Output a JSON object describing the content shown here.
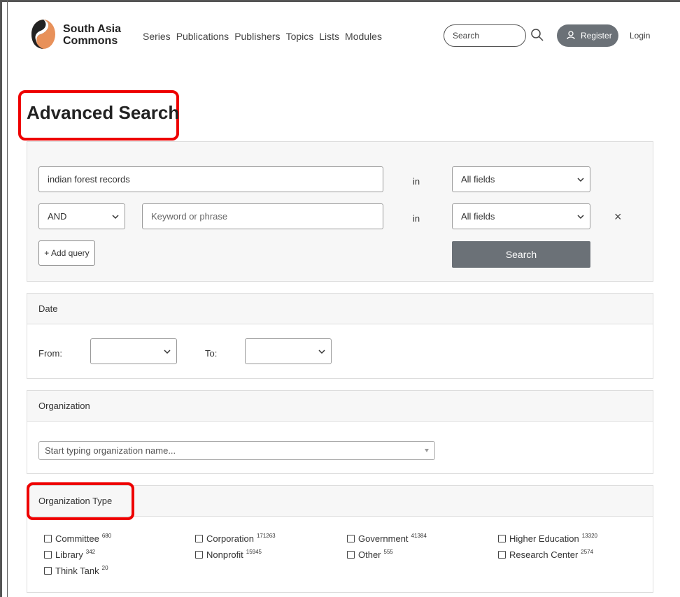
{
  "header": {
    "brand_line1": "South Asia",
    "brand_line2": "Commons",
    "nav": [
      "Series",
      "Publications",
      "Publishers",
      "Topics",
      "Lists",
      "Modules"
    ],
    "search_placeholder": "Search",
    "register_label": "Register",
    "login_label": "Login",
    "logo_colors": {
      "top": "#222222",
      "bottom": "#e8915a"
    }
  },
  "page_title": "Advanced Search",
  "query": {
    "row1_value": "indian forest records",
    "row1_in": "in",
    "row1_field": "All fields",
    "row2_operator": "AND",
    "row2_placeholder": "Keyword or phrase",
    "row2_in": "in",
    "row2_field": "All fields",
    "remove_icon": "×",
    "add_query_label": "+ Add query",
    "search_label": "Search"
  },
  "date": {
    "heading": "Date",
    "from_label": "From:",
    "to_label": "To:"
  },
  "organization": {
    "heading": "Organization",
    "placeholder": "Start typing organization name..."
  },
  "organization_type": {
    "heading": "Organization Type",
    "options": [
      {
        "label": "Committee",
        "count": "680"
      },
      {
        "label": "Corporation",
        "count": "171263"
      },
      {
        "label": "Government",
        "count": "41384"
      },
      {
        "label": "Higher Education",
        "count": "13320"
      },
      {
        "label": "Library",
        "count": "342"
      },
      {
        "label": "Nonprofit",
        "count": "15945"
      },
      {
        "label": "Other",
        "count": "555"
      },
      {
        "label": "Research Center",
        "count": "2574"
      },
      {
        "label": "Think Tank",
        "count": "20"
      }
    ]
  },
  "colors": {
    "highlight": "#e00000",
    "button": "#6b7177"
  }
}
